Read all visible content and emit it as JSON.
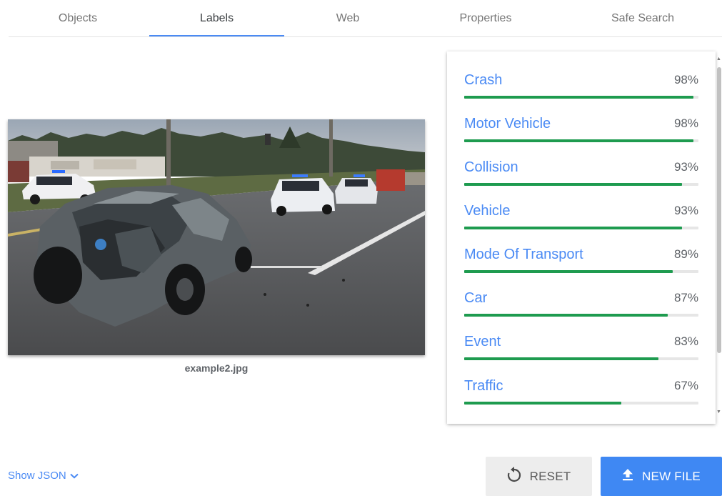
{
  "tabs": [
    {
      "label": "Objects",
      "active": false
    },
    {
      "label": "Labels",
      "active": true
    },
    {
      "label": "Web",
      "active": false
    },
    {
      "label": "Properties",
      "active": false
    },
    {
      "label": "Safe Search",
      "active": false
    }
  ],
  "image": {
    "caption": "example2.jpg"
  },
  "labels": [
    {
      "name": "Crash",
      "score_text": "98%",
      "score": 0.98
    },
    {
      "name": "Motor Vehicle",
      "score_text": "98%",
      "score": 0.98
    },
    {
      "name": "Collision",
      "score_text": "93%",
      "score": 0.93
    },
    {
      "name": "Vehicle",
      "score_text": "93%",
      "score": 0.93
    },
    {
      "name": "Mode Of Transport",
      "score_text": "89%",
      "score": 0.89
    },
    {
      "name": "Car",
      "score_text": "87%",
      "score": 0.87
    },
    {
      "name": "Event",
      "score_text": "83%",
      "score": 0.83
    },
    {
      "name": "Traffic",
      "score_text": "67%",
      "score": 0.67
    }
  ],
  "footer": {
    "show_json_label": "Show JSON",
    "reset_label": "RESET",
    "new_file_label": "NEW FILE"
  },
  "colors": {
    "accent": "#4a8af4",
    "bar_fill": "#1e9b4f",
    "bar_track": "#e6e6e6",
    "new_file_button": "#3f88f3",
    "reset_button": "#ededed"
  },
  "icons": {
    "show_json": "chevron-down-icon",
    "reset": "undo-icon",
    "new_file": "upload-icon"
  }
}
